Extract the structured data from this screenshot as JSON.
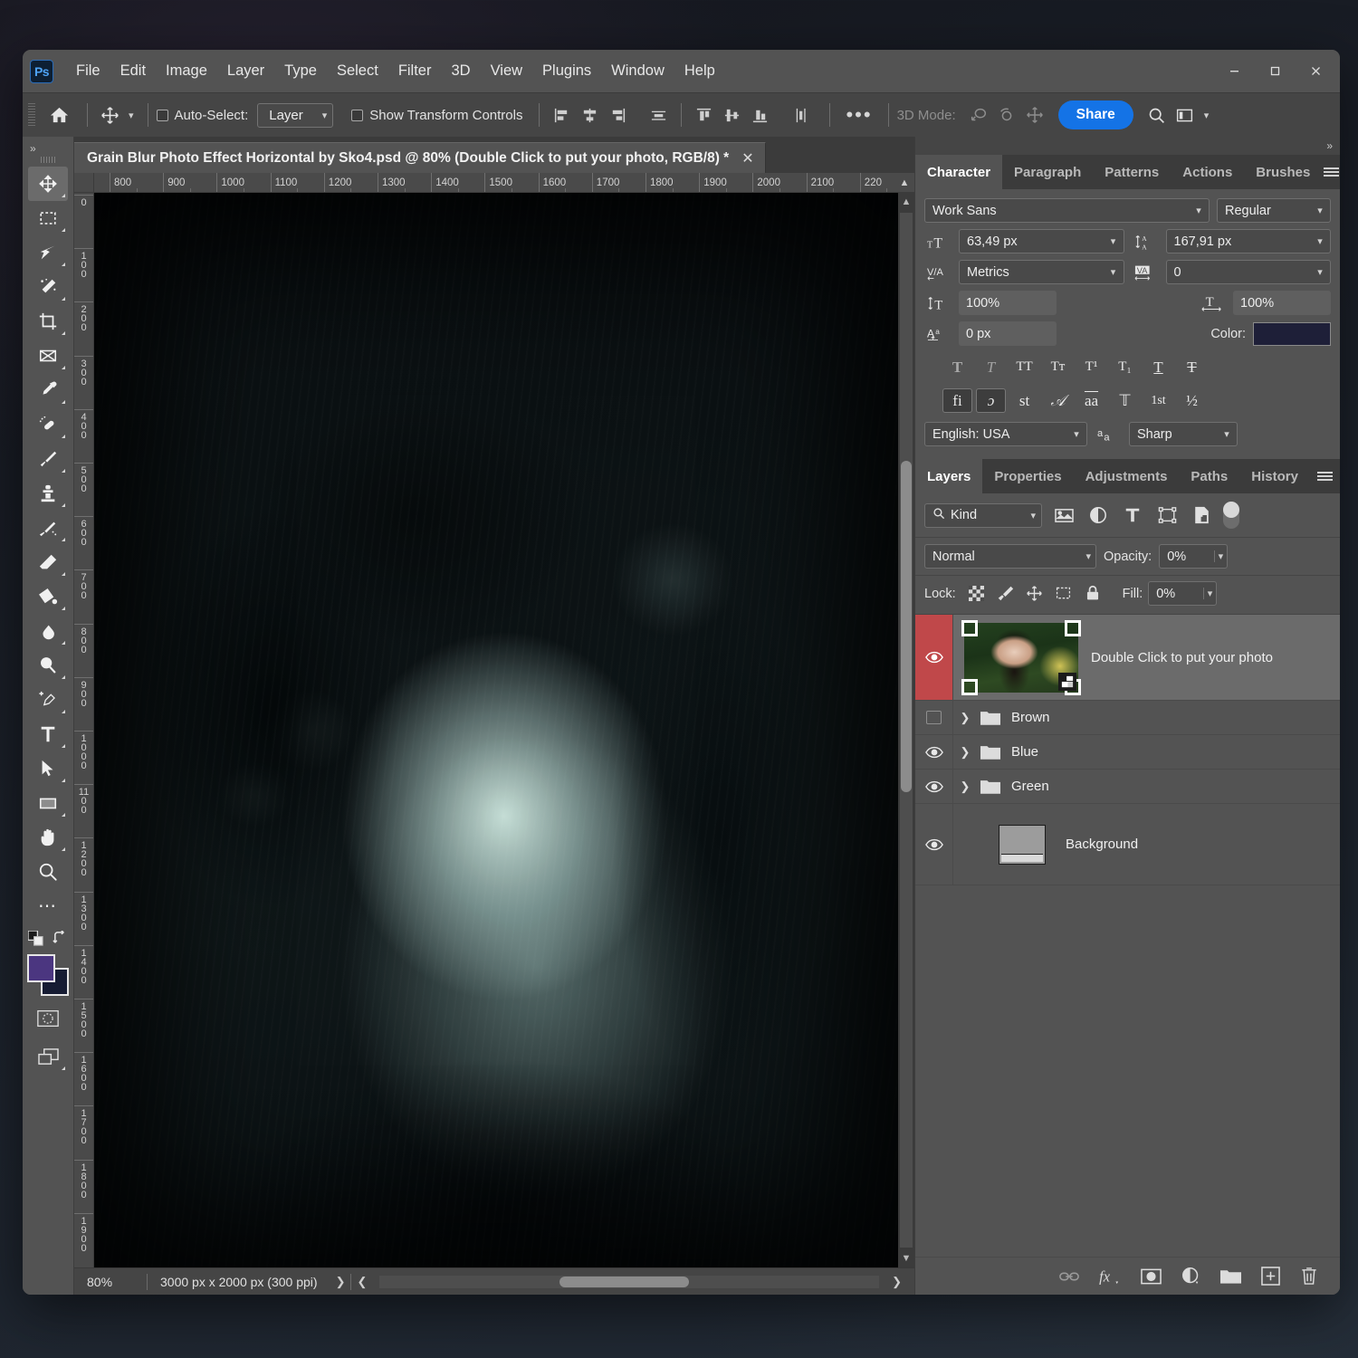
{
  "app": {
    "name": "Adobe Photoshop",
    "logo_text": "Ps",
    "accent_blue": "#1473e6",
    "chrome_bg": "#535353",
    "selection_red": "#c0484a"
  },
  "menubar": {
    "items": [
      "File",
      "Edit",
      "Image",
      "Layer",
      "Type",
      "Select",
      "Filter",
      "3D",
      "View",
      "Plugins",
      "Window",
      "Help"
    ]
  },
  "window_controls": {
    "minimize": "minimize-icon",
    "maximize": "maximize-icon",
    "close": "close-icon"
  },
  "options_bar": {
    "home_icon": "home-icon",
    "tool_icon": "move-tool-icon",
    "auto_select_label": "Auto-Select:",
    "auto_select_checked": false,
    "auto_select_scope": "Layer",
    "show_transform_label": "Show Transform Controls",
    "show_transform_checked": false,
    "align_icons": [
      "align-left-edges-icon",
      "align-horizontal-centers-icon",
      "align-right-edges-icon",
      "distribute-horizontal-icon",
      "align-top-edges-icon",
      "align-vertical-centers-icon",
      "align-bottom-edges-icon",
      "distribute-vertical-icon"
    ],
    "more_label": "•••",
    "mode3d_label": "3D Mode:",
    "mode3d_icons": [
      "orbit-3d-icon",
      "roll-3d-icon",
      "pan-3d-icon"
    ],
    "share_label": "Share",
    "search_icon": "search-icon",
    "workspace_icon": "workspace-switcher-icon",
    "chevron_icon": "chevron-down-icon"
  },
  "toolbar": {
    "tools": [
      {
        "name": "move-tool",
        "glyph": "move"
      },
      {
        "name": "rectangular-marquee-tool",
        "glyph": "marquee"
      },
      {
        "name": "lasso-tool",
        "glyph": "lasso"
      },
      {
        "name": "object-selection-tool",
        "glyph": "wand"
      },
      {
        "name": "crop-tool",
        "glyph": "crop"
      },
      {
        "name": "frame-tool",
        "glyph": "frame"
      },
      {
        "name": "eyedropper-tool",
        "glyph": "eyedropper"
      },
      {
        "name": "spot-healing-brush-tool",
        "glyph": "healing"
      },
      {
        "name": "brush-tool",
        "glyph": "brush"
      },
      {
        "name": "clone-stamp-tool",
        "glyph": "stamp"
      },
      {
        "name": "history-brush-tool",
        "glyph": "historybrush"
      },
      {
        "name": "eraser-tool",
        "glyph": "eraser"
      },
      {
        "name": "gradient-tool",
        "glyph": "bucket"
      },
      {
        "name": "blur-tool",
        "glyph": "blur"
      },
      {
        "name": "dodge-tool",
        "glyph": "dodge"
      },
      {
        "name": "pen-tool",
        "glyph": "pen"
      },
      {
        "name": "horizontal-type-tool",
        "glyph": "type"
      },
      {
        "name": "path-selection-tool",
        "glyph": "pathselect"
      },
      {
        "name": "rectangle-tool",
        "glyph": "rectangle"
      },
      {
        "name": "hand-tool",
        "glyph": "hand"
      },
      {
        "name": "zoom-tool",
        "glyph": "zoom"
      },
      {
        "name": "edit-toolbar",
        "glyph": "dots"
      }
    ],
    "active_tool": "move-tool",
    "foreground_color": "#4b3680",
    "background_color": "#161c33",
    "default_colors_icon": "default-colors-icon",
    "swap_colors_icon": "swap-colors-icon",
    "quick_mask_icon": "quick-mask-icon",
    "screen_mode_icon": "screen-mode-icon"
  },
  "document": {
    "tab_title": "Grain Blur Photo Effect Horizontal by Sko4.psd @ 80% (Double Click to put your photo, RGB/8) *",
    "close_icon": "close-icon",
    "h_ruler_ticks": [
      "800",
      "900",
      "1000",
      "1100",
      "1200",
      "1300",
      "1400",
      "1500",
      "1600",
      "1700",
      "1800",
      "1900",
      "2000",
      "2100",
      "220"
    ],
    "v_ruler_ticks": [
      "0",
      "100",
      "200",
      "300",
      "400",
      "500",
      "600",
      "700",
      "800",
      "900",
      "1000",
      "1100",
      "1200",
      "1300",
      "1400",
      "1500",
      "1600",
      "1700",
      "1800",
      "1900"
    ]
  },
  "status_bar": {
    "zoom": "80%",
    "dimensions": "3000 px x 2000 px (300 ppi)",
    "expand_icon": "chevron-right-icon",
    "left_icon": "chevron-left-icon",
    "right_icon": "chevron-right-icon"
  },
  "right_panels": {
    "collapse_icon": "collapse-panels-icon",
    "top_group": {
      "tabs": [
        "Character",
        "Paragraph",
        "Patterns",
        "Actions",
        "Brushes"
      ],
      "active_tab": "Character",
      "menu_icon": "panel-menu-icon"
    },
    "character": {
      "font_family": "Work Sans",
      "font_style": "Regular",
      "font_size_icon": "font-size-icon",
      "font_size": "63,49 px",
      "leading_icon": "leading-icon",
      "leading": "167,91 px",
      "kerning_icon": "kerning-icon",
      "kerning": "Metrics",
      "tracking_icon": "tracking-icon",
      "tracking": "0",
      "vertical_scale_icon": "vertical-scale-icon",
      "vertical_scale": "100%",
      "horizontal_scale_icon": "horizontal-scale-icon",
      "horizontal_scale": "100%",
      "baseline_shift_icon": "baseline-shift-icon",
      "baseline_shift": "0 px",
      "color_label": "Color:",
      "color_value": "#1e1f38",
      "style_row_1": [
        {
          "name": "faux-bold-button",
          "glyph": "T",
          "on": false
        },
        {
          "name": "faux-italic-button",
          "glyph": "T",
          "on": false
        },
        {
          "name": "all-caps-button",
          "glyph": "TT",
          "on": false
        },
        {
          "name": "small-caps-button",
          "glyph": "Tᴛ",
          "on": false
        },
        {
          "name": "superscript-button",
          "glyph": "T¹",
          "on": false
        },
        {
          "name": "subscript-button",
          "glyph": "T₁",
          "on": false
        },
        {
          "name": "underline-button",
          "glyph": "T",
          "on": false
        },
        {
          "name": "strikethrough-button",
          "glyph": "T",
          "on": false
        }
      ],
      "style_row_2": [
        {
          "name": "standard-ligatures-button",
          "glyph": "fi",
          "on": true
        },
        {
          "name": "contextual-alternates-button",
          "glyph": "ɔ",
          "on": true
        },
        {
          "name": "discretionary-ligatures-button",
          "glyph": "st",
          "on": false
        },
        {
          "name": "swash-button",
          "glyph": "𝒜",
          "on": false
        },
        {
          "name": "titling-alternates-button",
          "glyph": "aa",
          "on": false
        },
        {
          "name": "stylistic-alternates-button",
          "glyph": "𝕋",
          "on": false
        },
        {
          "name": "ordinals-button",
          "glyph": "1st",
          "on": false
        },
        {
          "name": "fractions-button",
          "glyph": "½",
          "on": false
        }
      ],
      "language": "English: USA",
      "antialias_icon": "anti-alias-icon",
      "antialias": "Sharp"
    },
    "bottom_group": {
      "tabs": [
        "Layers",
        "Properties",
        "Adjustments",
        "Paths",
        "History"
      ],
      "active_tab": "Layers",
      "menu_icon": "panel-menu-icon"
    },
    "layers": {
      "filter_label": "Kind",
      "filter_search_icon": "search-icon",
      "filter_icons": [
        "filter-pixel-icon",
        "filter-adjustment-icon",
        "filter-type-icon",
        "filter-shape-icon",
        "filter-smart-object-icon"
      ],
      "filter_toggle": "filter-enable-toggle",
      "blend_mode": "Normal",
      "opacity_label": "Opacity:",
      "opacity_value": "0%",
      "lock_label": "Lock:",
      "lock_icons": [
        "lock-transparent-pixels-icon",
        "lock-image-pixels-icon",
        "lock-position-icon",
        "lock-artboard-nesting-icon",
        "lock-all-icon"
      ],
      "fill_label": "Fill:",
      "fill_value": "0%",
      "rows": [
        {
          "name": "Double Click to put your photo",
          "type": "smart-object",
          "visible": true,
          "selected": true,
          "flagged": true,
          "expandable": false
        },
        {
          "name": "Brown",
          "type": "group",
          "visible": false,
          "selected": false,
          "flagged": false,
          "expandable": true
        },
        {
          "name": "Blue",
          "type": "group",
          "visible": true,
          "selected": false,
          "flagged": false,
          "expandable": true
        },
        {
          "name": "Green",
          "type": "group",
          "visible": true,
          "selected": false,
          "flagged": false,
          "expandable": true
        },
        {
          "name": "Background",
          "type": "background",
          "visible": true,
          "selected": false,
          "flagged": false,
          "expandable": false
        }
      ],
      "footer_icons": [
        "link-layers-icon",
        "add-layer-style-icon",
        "add-layer-mask-icon",
        "new-adjustment-layer-icon",
        "new-group-icon",
        "new-layer-icon",
        "delete-layer-icon"
      ]
    }
  }
}
